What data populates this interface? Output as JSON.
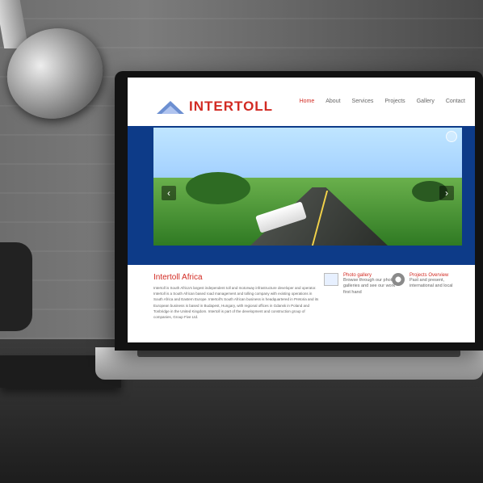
{
  "site": {
    "logo_text": "INTERTOLL",
    "nav": [
      {
        "label": "Home",
        "active": true
      },
      {
        "label": "About",
        "active": false
      },
      {
        "label": "Services",
        "active": false
      },
      {
        "label": "Projects",
        "active": false
      },
      {
        "label": "Gallery",
        "active": false
      },
      {
        "label": "Contact",
        "active": false
      }
    ]
  },
  "intro": {
    "title": "Intertoll Africa",
    "text": "Intertoll is South Africa's largest independent toll and motorway infrastructure developer and operator. Intertoll is a South African based road management and tolling company with existing operations in South Africa and Eastern Europe. Intertoll's South African business is headquartered in Pretoria and its European business is based in Budapest, Hungary, with regional offices in Gdansk in Poland and Tonbridge in the United Kingdom. Intertoll is part of the development and construction group of companies, Group Five Ltd."
  },
  "features": {
    "gallery": {
      "title": "Photo gallery",
      "desc": "Browse through our photo galleries and see our work first hand"
    },
    "projects": {
      "title": "Projects Overview",
      "desc": "Past and present, international and local"
    }
  }
}
